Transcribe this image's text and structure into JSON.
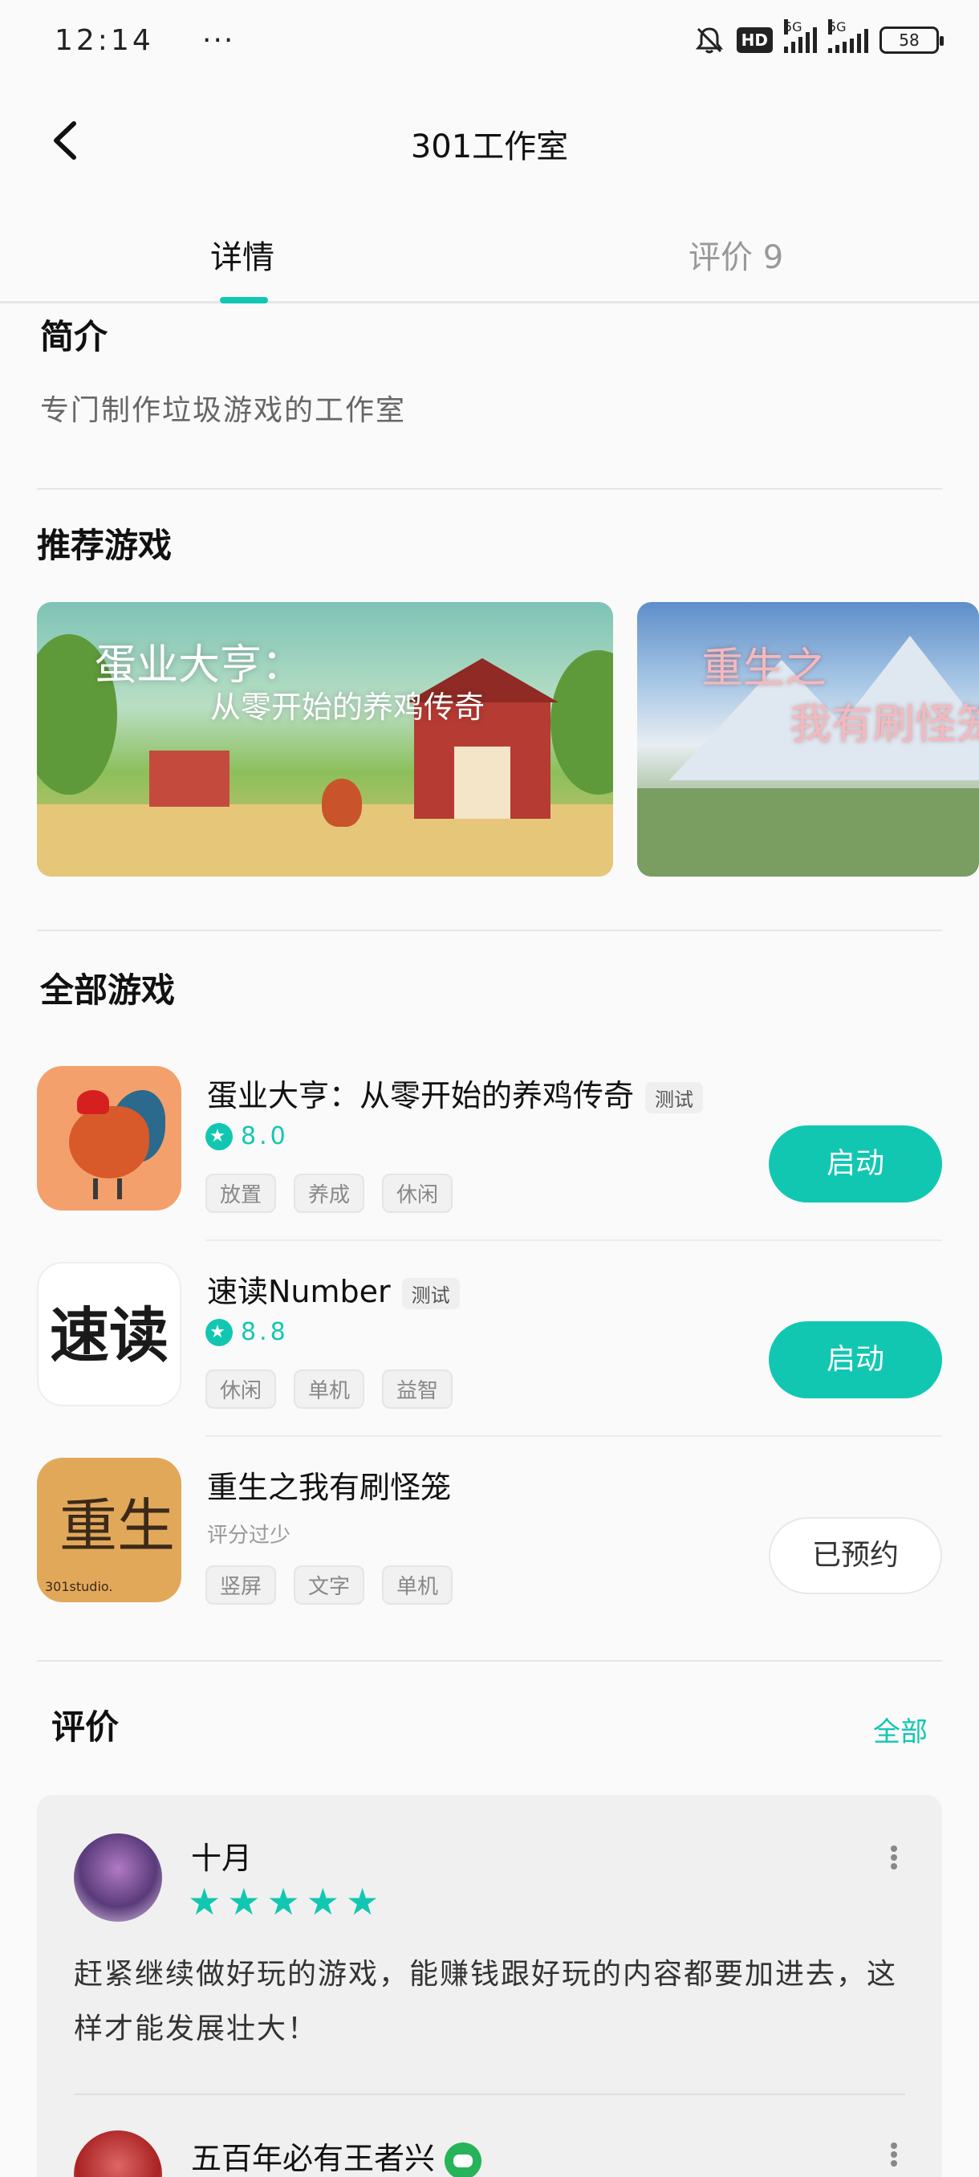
{
  "status_bar": {
    "time": "12:14",
    "dots": "···",
    "hd": "HD",
    "net1": "5G",
    "net2": "5G",
    "battery": "58"
  },
  "header": {
    "title": "301工作室"
  },
  "tabs": [
    {
      "label": "详情"
    },
    {
      "label": "评价 9"
    }
  ],
  "intro": {
    "title": "简介",
    "text": "专门制作垃圾游戏的工作室"
  },
  "recommended": {
    "title": "推荐游戏",
    "banners": [
      {
        "title": "蛋业大亨：",
        "subtitle": "从零开始的养鸡传奇"
      },
      {
        "title": "重生之",
        "subtitle": "我有刷怪笼"
      }
    ]
  },
  "all_games": {
    "title": "全部游戏",
    "items": [
      {
        "name": "蛋业大亨：从零开始的养鸡传奇",
        "badge": "测试",
        "rating": 8.0,
        "rating_text": "8.0",
        "tags": [
          "放置",
          "养成",
          "休闲"
        ],
        "action": "启动"
      },
      {
        "name": "速读Number",
        "badge": "测试",
        "rating": 8.8,
        "rating_text": "8.8",
        "icon_text": "速读",
        "tags": [
          "休闲",
          "单机",
          "益智"
        ],
        "action": "启动"
      },
      {
        "name": "重生之我有刷怪笼",
        "rating_text": "评分过少",
        "icon_text": "重生",
        "icon_small": "301studio.",
        "tags": [
          "竖屏",
          "文字",
          "单机"
        ],
        "action": "已预约"
      }
    ]
  },
  "reviews": {
    "title": "评价",
    "all_label": "全部",
    "items": [
      {
        "name": "十月",
        "stars": 5,
        "text": "赶紧继续做好玩的游戏，能赚钱跟好玩的内容都要加进去，这样才能发展壮大！"
      },
      {
        "name": "五百年必有王者兴"
      }
    ]
  },
  "colors": {
    "accent": "#12c7b2",
    "background": "#fafafa"
  },
  "icons": [
    "back-arrow-icon",
    "mute-bell-icon",
    "signal-icon",
    "battery-icon",
    "rating-star-icon",
    "more-vertical-icon",
    "gamepad-badge-icon"
  ]
}
